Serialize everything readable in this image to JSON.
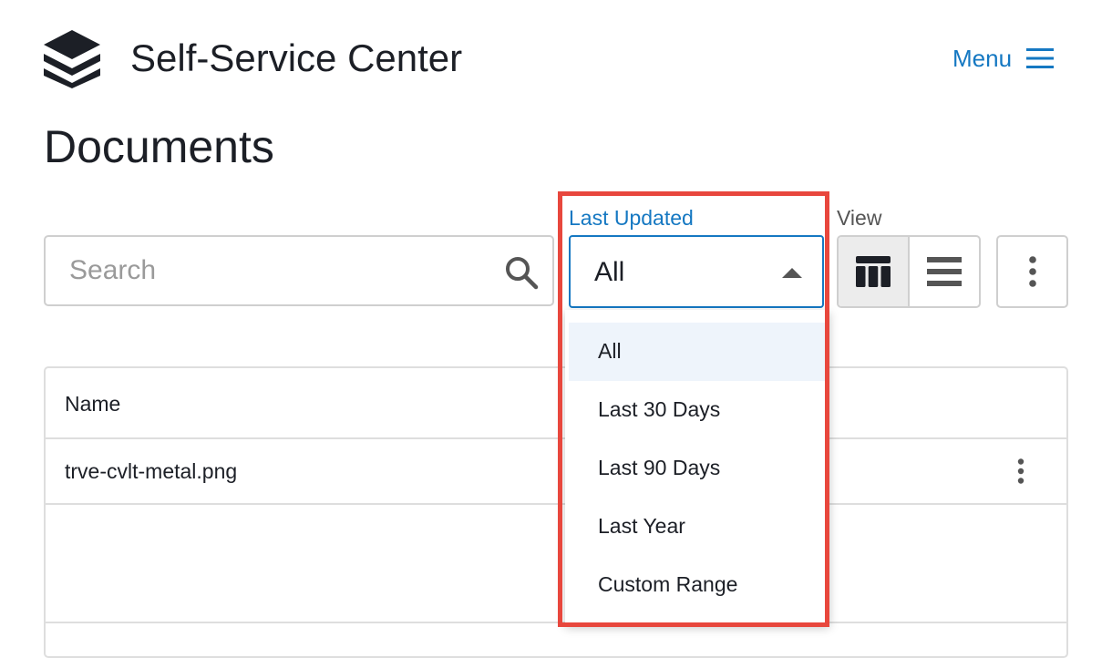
{
  "header": {
    "app_title": "Self-Service Center",
    "menu_label": "Menu",
    "logo_icon": "stacked-layers-logo",
    "menu_icon": "hamburger-icon"
  },
  "page": {
    "title": "Documents"
  },
  "toolbar": {
    "search": {
      "placeholder": "Search",
      "value": "",
      "icon": "search-icon"
    },
    "filter": {
      "label": "Last Updated",
      "selected_value": "All",
      "is_open": true,
      "options": [
        "All",
        "Last 30 Days",
        "Last 90 Days",
        "Last Year",
        "Custom Range"
      ]
    },
    "view": {
      "label": "View",
      "options": [
        {
          "icon": "tile-view-icon",
          "active": true
        },
        {
          "icon": "list-view-icon",
          "active": false
        }
      ]
    },
    "more_icon": "kebab-menu-icon"
  },
  "table": {
    "columns": [
      "Name"
    ],
    "rows": [
      {
        "name": "trve-cvlt-metal.png",
        "action_icon": "kebab-menu-icon"
      }
    ]
  },
  "colors": {
    "accent": "#1578c2",
    "highlight": "#e8473d",
    "selected_option_bg": "#eef4fb",
    "text": "#1c1f26"
  }
}
